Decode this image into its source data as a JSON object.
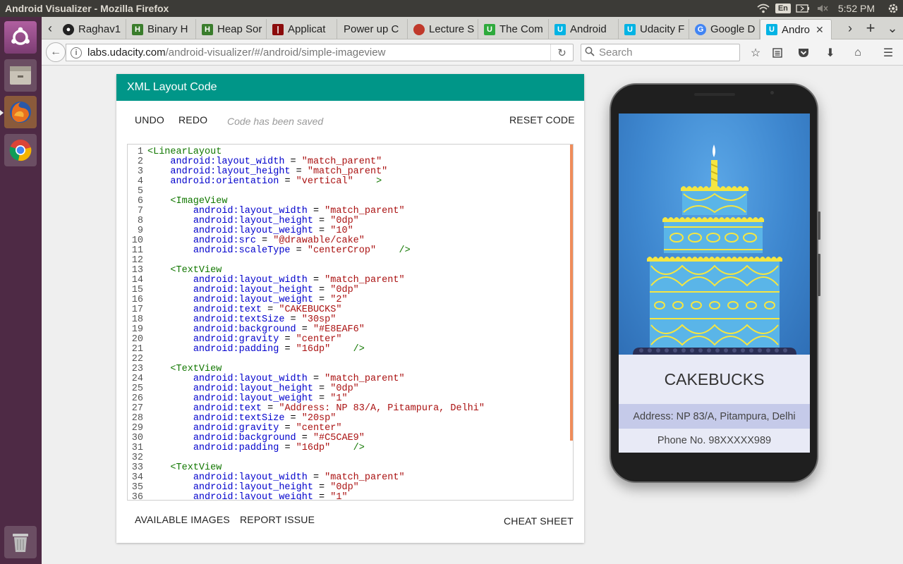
{
  "os": {
    "window_title": "Android Visualizer - Mozilla Firefox",
    "keyboard_layout": "En",
    "clock": "5:52 PM"
  },
  "browser": {
    "tabs": [
      {
        "label": "Raghav1",
        "icon": "github-icon"
      },
      {
        "label": "Binary H",
        "icon": "hackerrank-icon"
      },
      {
        "label": "Heap Sor",
        "icon": "hackerrank-icon"
      },
      {
        "label": "Applicat",
        "icon": "bookmark-icon"
      },
      {
        "label": "Power up C",
        "icon": "none"
      },
      {
        "label": "Lecture S",
        "icon": "apple-icon"
      },
      {
        "label": "The Com",
        "icon": "upwork-icon"
      },
      {
        "label": "Android",
        "icon": "udacity-icon"
      },
      {
        "label": "Udacity F",
        "icon": "udacity-icon"
      },
      {
        "label": "Google D",
        "icon": "google-icon"
      },
      {
        "label": "Andro",
        "icon": "udacity-icon"
      }
    ],
    "url_domain": "labs.udacity.com",
    "url_path": "/android-visualizer/#/android/simple-imageview",
    "search_placeholder": "Search"
  },
  "editor_panel": {
    "title": "XML Layout Code",
    "undo": "UNDO",
    "redo": "REDO",
    "saved_status": "Code has been saved",
    "reset": "RESET CODE",
    "available_images": "AVAILABLE IMAGES",
    "report_issue": "REPORT ISSUE",
    "cheat_sheet": "CHEAT SHEET"
  },
  "code_lines": [
    "<LinearLayout",
    "    android:layout_width = \"match_parent\"",
    "    android:layout_height = \"match_parent\"",
    "    android:orientation = \"vertical\"    >",
    "",
    "    <ImageView",
    "        android:layout_width = \"match_parent\"",
    "        android:layout_height = \"0dp\"",
    "        android:layout_weight = \"10\"",
    "        android:src = \"@drawable/cake\"",
    "        android:scaleType = \"centerCrop\"    />",
    "",
    "    <TextView",
    "        android:layout_width = \"match_parent\"",
    "        android:layout_height = \"0dp\"",
    "        android:layout_weight = \"2\"",
    "        android:text = \"CAKEBUCKS\"",
    "        android:textSize = \"30sp\"",
    "        android:background = \"#E8EAF6\"",
    "        android:gravity = \"center\"",
    "        android:padding = \"16dp\"    />",
    "",
    "    <TextView",
    "        android:layout_width = \"match_parent\"",
    "        android:layout_height = \"0dp\"",
    "        android:layout_weight = \"1\"",
    "        android:text = \"Address: NP 83/A, Pitampura, Delhi\"",
    "        android:textSize = \"20sp\"",
    "        android:gravity = \"center\"",
    "        android:background = \"#C5CAE9\"",
    "        android:padding = \"16dp\"    />",
    "",
    "    <TextView",
    "        android:layout_width = \"match_parent\"",
    "        android:layout_height = \"0dp\"",
    "        android:layout_weight = \"1\""
  ],
  "preview": {
    "title": "CAKEBUCKS",
    "address": "Address: NP 83/A, Pitampura, Delhi",
    "phone": "Phone No. 98XXXXX989",
    "title_bg": "#E8EAF6",
    "address_bg": "#C5CAE9"
  },
  "colors": {
    "accent": "#009688",
    "launcher": "#4e2a45",
    "scroll_marker": "#ef8c5a"
  }
}
